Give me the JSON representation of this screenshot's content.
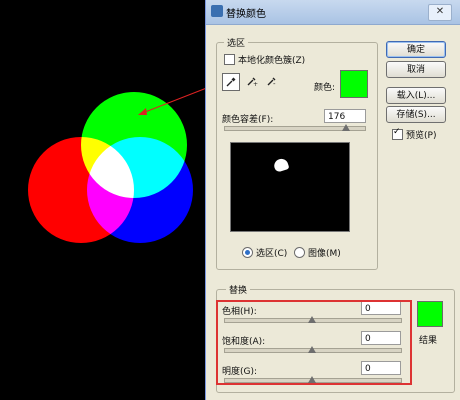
{
  "window": {
    "title": "替换颜色",
    "close_symbol": "✕"
  },
  "selection": {
    "legend": "选区",
    "localized_label": "本地化颜色簇(Z)",
    "localized_checked": false,
    "color_label": "颜色:",
    "color_value": "#00ff00",
    "fuzziness_label": "颜色容差(F):",
    "fuzziness_value": "176",
    "fuzziness_level": 0.88,
    "radio_selection": "选区(C)",
    "radio_image": "图像(M)",
    "selected_radio": "selection"
  },
  "replacement": {
    "legend": "替换",
    "hue_label": "色相(H):",
    "hue_value": "0",
    "saturation_label": "饱和度(A):",
    "saturation_value": "0",
    "lightness_label": "明度(G):",
    "lightness_value": "0",
    "result_label": "结果",
    "result_color": "#00ff00"
  },
  "buttons": {
    "ok": "确定",
    "cancel": "取消",
    "load": "载入(L)...",
    "save": "存储(S)...",
    "preview_label": "预览(P)",
    "preview_checked": true
  },
  "icons": {
    "eyedropper": "eyedropper-icon",
    "eyedropper_plus": "eyedropper-plus-icon",
    "eyedropper_minus": "eyedropper-minus-icon"
  }
}
